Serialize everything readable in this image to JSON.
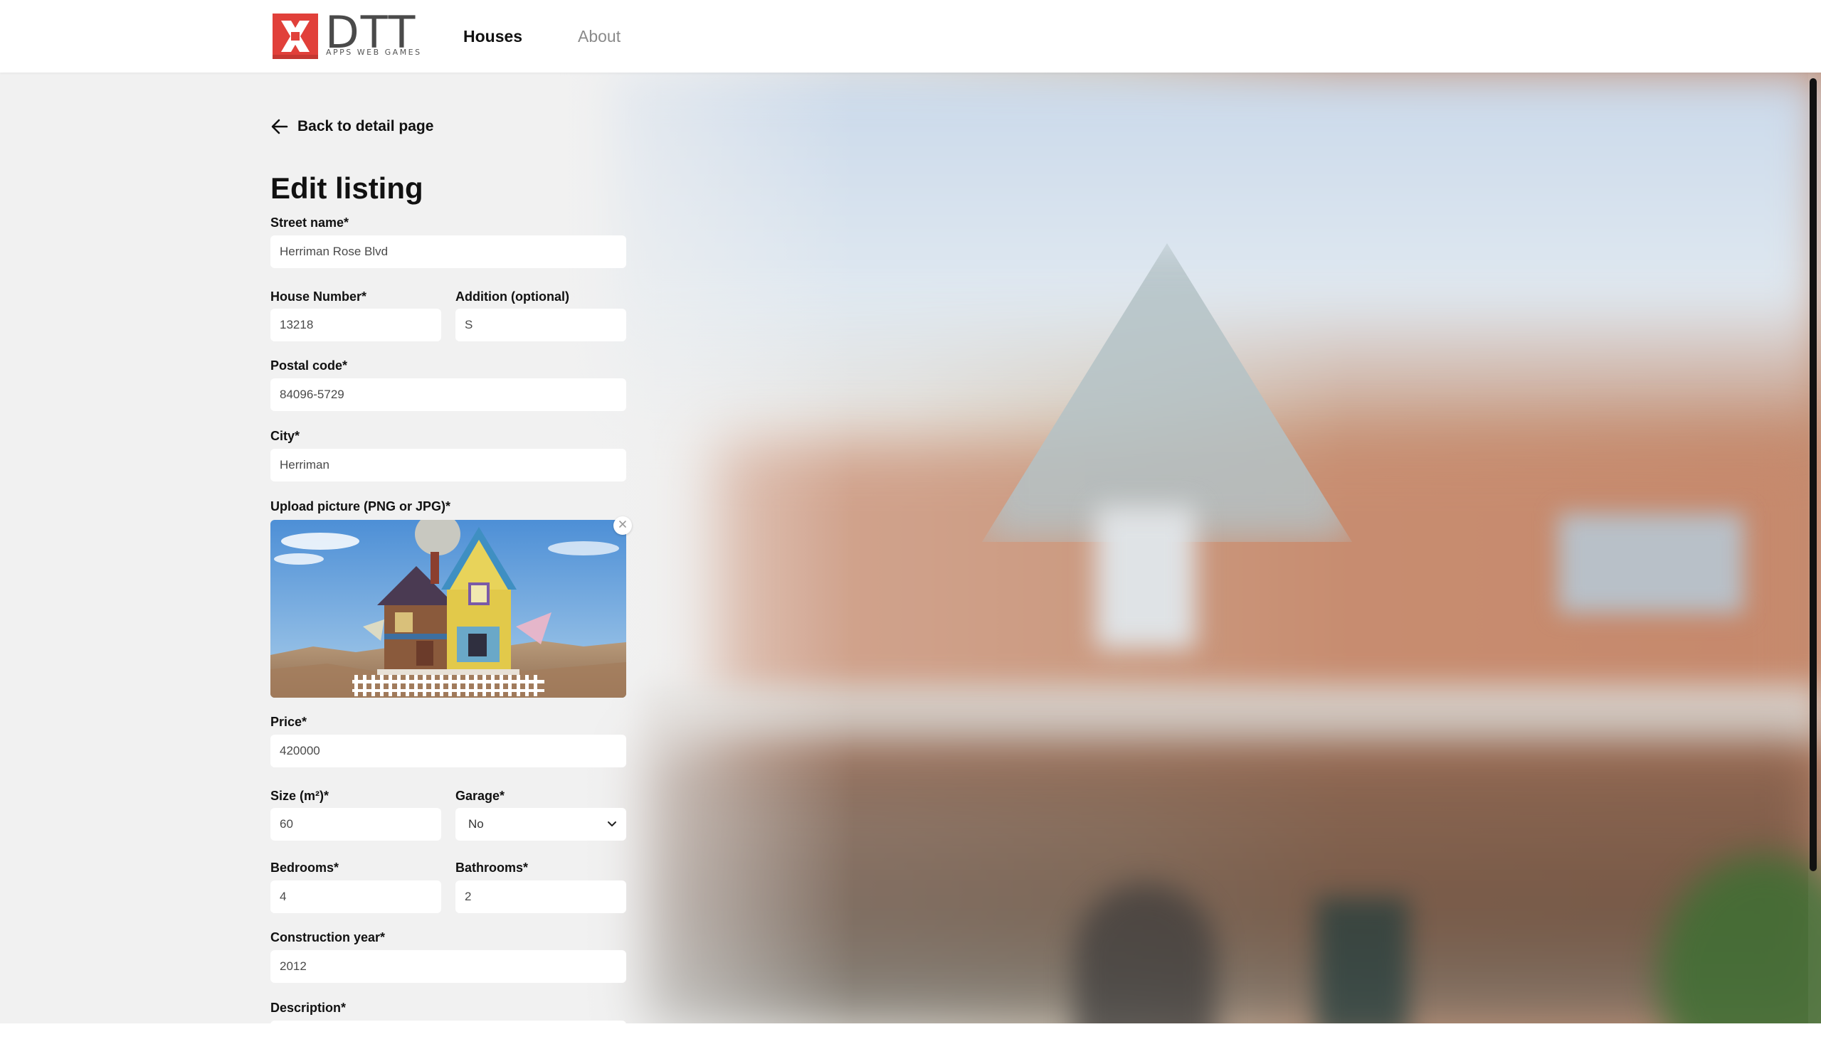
{
  "header": {
    "logo_text": "DTT",
    "logo_tagline": "APPS WEB GAMES",
    "nav": [
      {
        "label": "Houses",
        "active": true
      },
      {
        "label": "About",
        "active": false
      }
    ]
  },
  "back_link": {
    "label": "Back to detail page",
    "icon": "arrow-left-icon"
  },
  "page_title": "Edit listing",
  "form": {
    "street": {
      "label": "Street name*",
      "value": "Herriman Rose Blvd"
    },
    "house_number": {
      "label": "House Number*",
      "value": "13218"
    },
    "addition": {
      "label": "Addition (optional)",
      "value": "S"
    },
    "postal_code": {
      "label": "Postal code*",
      "value": "84096-5729"
    },
    "city": {
      "label": "City*",
      "value": "Herriman"
    },
    "upload": {
      "label": "Upload picture (PNG or JPG)*",
      "remove_icon": "close-icon"
    },
    "price": {
      "label": "Price*",
      "value": "420000"
    },
    "size": {
      "label": "Size (m²)*",
      "value": "60"
    },
    "garage": {
      "label": "Garage*",
      "value": "No",
      "icon": "chevron-down-icon"
    },
    "bedrooms": {
      "label": "Bedrooms*",
      "value": "4"
    },
    "bathrooms": {
      "label": "Bathrooms*",
      "value": "2"
    },
    "construction_year": {
      "label": "Construction year*",
      "value": "2012"
    },
    "description": {
      "label": "Description*"
    }
  },
  "colors": {
    "brand_red": "#e1403a",
    "field_bg": "#ffffff",
    "page_bg": "#f1f1f1"
  }
}
